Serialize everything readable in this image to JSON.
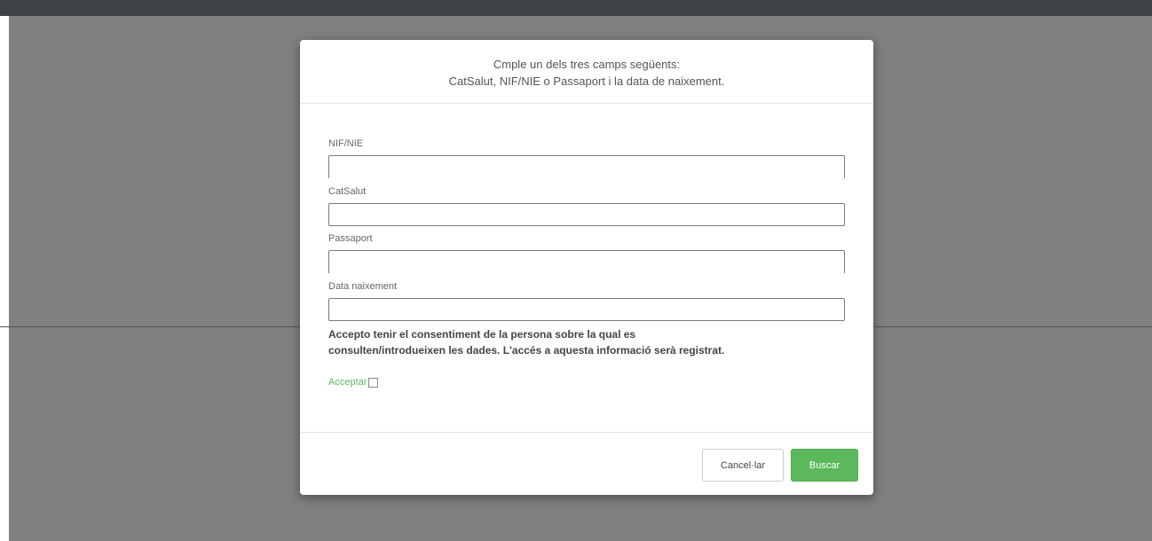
{
  "modal": {
    "header_line1": "Cmple un dels tres camps següents:",
    "header_line2": "CatSalut, NIF/NIE o Passaport i la data de naixement.",
    "fields": [
      {
        "label": "NIF/NIE",
        "value": ""
      },
      {
        "label": "CatSalut",
        "value": ""
      },
      {
        "label": "Passaport",
        "value": ""
      },
      {
        "label": "Data naixement",
        "value": ""
      }
    ],
    "consent_line1": "Accepto tenir el consentiment de la persona sobre la qual es",
    "consent_line2": "consulten/introdueixen les dades. L'accés a aquesta informació serà registrat.",
    "accept_label": "Acceptar",
    "accept_checked": false,
    "cancel_label": "Cancel·lar",
    "search_label": "Buscar"
  },
  "colors": {
    "top_bar": "#3e4347",
    "overlay": "#808080",
    "accent_green": "#5cb85c"
  }
}
